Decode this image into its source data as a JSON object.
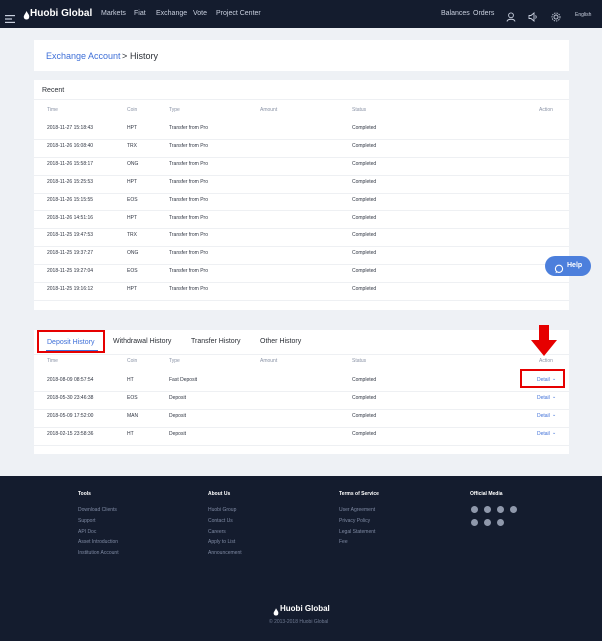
{
  "nav": {
    "logo": "Huobi Global",
    "left": [
      "Markets",
      "Fiat",
      "Exchange",
      "Vote",
      "Project Center"
    ],
    "right": [
      "Balances",
      "Orders"
    ],
    "language": "English"
  },
  "breadcrumb": {
    "parent": "Exchange Account",
    "separator": ">",
    "current": "History"
  },
  "recent": {
    "title": "Recent",
    "columns": [
      "Time",
      "Coin",
      "Type",
      "Amount",
      "Status",
      "Action"
    ],
    "rows": [
      {
        "time": "2018-11-27 15:18:43",
        "coin": "HPT",
        "type": "Transfer from Pro",
        "status": "Completed"
      },
      {
        "time": "2018-11-26 16:08:40",
        "coin": "TRX",
        "type": "Transfer from Pro",
        "status": "Completed"
      },
      {
        "time": "2018-11-26 15:58:17",
        "coin": "ONG",
        "type": "Transfer from Pro",
        "status": "Completed"
      },
      {
        "time": "2018-11-26 15:25:53",
        "coin": "HPT",
        "type": "Transfer from Pro",
        "status": "Completed"
      },
      {
        "time": "2018-11-26 15:15:55",
        "coin": "EOS",
        "type": "Transfer from Pro",
        "status": "Completed"
      },
      {
        "time": "2018-11-26 14:51:16",
        "coin": "HPT",
        "type": "Transfer from Pro",
        "status": "Completed"
      },
      {
        "time": "2018-11-25 19:47:53",
        "coin": "TRX",
        "type": "Transfer from Pro",
        "status": "Completed"
      },
      {
        "time": "2018-11-25 19:37:27",
        "coin": "ONG",
        "type": "Transfer from Pro",
        "status": "Completed"
      },
      {
        "time": "2018-11-25 19:27:04",
        "coin": "EOS",
        "type": "Transfer from Pro",
        "status": "Completed"
      },
      {
        "time": "2018-11-25 19:16:12",
        "coin": "HPT",
        "type": "Transfer from Pro",
        "status": "Completed"
      }
    ]
  },
  "help": {
    "label": "Help"
  },
  "history": {
    "tabs": [
      "Deposit History",
      "Withdrawal History",
      "Transfer History",
      "Other History"
    ],
    "columns": [
      "Time",
      "Coin",
      "Type",
      "Amount",
      "Status",
      "Action"
    ],
    "rows": [
      {
        "time": "2018-08-09 08:57:54",
        "coin": "HT",
        "type": "Fast Deposit",
        "status": "Completed",
        "action": "Detail"
      },
      {
        "time": "2018-05-30 23:46:38",
        "coin": "EOS",
        "type": "Deposit",
        "status": "Completed",
        "action": "Detail"
      },
      {
        "time": "2018-05-09 17:52:00",
        "coin": "MAN",
        "type": "Deposit",
        "status": "Completed",
        "action": "Detail"
      },
      {
        "time": "2018-02-15 23:58:36",
        "coin": "HT",
        "type": "Deposit",
        "status": "Completed",
        "action": "Detail"
      }
    ]
  },
  "footer": {
    "tools": {
      "title": "Tools",
      "links": [
        "Download Clients",
        "Support",
        "API Doc",
        "Asset Introduction",
        "Institution Account"
      ]
    },
    "about": {
      "title": "About Us",
      "links": [
        "Huobi Group",
        "Contact Us",
        "Careers",
        "Apply to List",
        "Announcement"
      ]
    },
    "terms": {
      "title": "Terms of Service",
      "links": [
        "User Agreement",
        "Privacy Policy",
        "Legal Statement",
        "Fee"
      ]
    },
    "media": {
      "title": "Official Media"
    },
    "logo": "Huobi Global",
    "copyright": "© 2013-2018 Huobi Global"
  },
  "colors": {
    "nav_bg": "#141c2e",
    "link": "#3e6fd8",
    "highlight": "#e60000",
    "help_bg": "#4c7fdc"
  }
}
